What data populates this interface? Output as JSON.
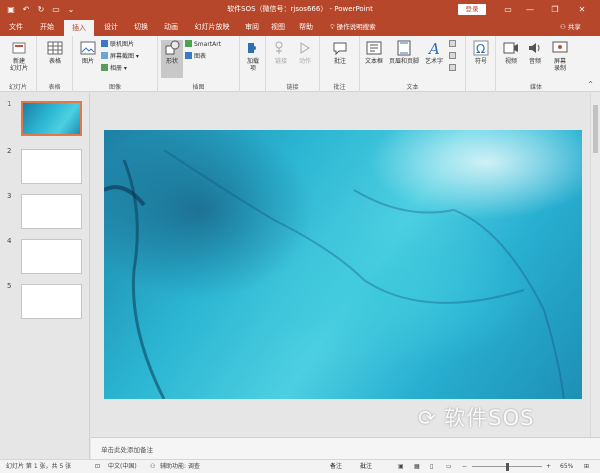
{
  "titlebar": {
    "doc_title": "软件SOS（微信号：rjsos666） - PowerPoint",
    "login": "登录",
    "minimize": "—",
    "restore": "❐",
    "close": "✕"
  },
  "tabs": [
    {
      "label": "文件"
    },
    {
      "label": "开始"
    },
    {
      "label": "插入"
    },
    {
      "label": "设计"
    },
    {
      "label": "切换"
    },
    {
      "label": "动画"
    },
    {
      "label": "幻灯片放映"
    },
    {
      "label": "审阅"
    },
    {
      "label": "视图"
    },
    {
      "label": "帮助"
    }
  ],
  "active_tab": "插入",
  "tell_me": "操作说明搜索",
  "share": "共享",
  "ribbon": {
    "groups": {
      "slides": "幻灯片",
      "tables": "表格",
      "images": "图像",
      "illustrations": "插图",
      "links": "链接",
      "comments": "批注",
      "text": "文本",
      "symbols": "",
      "media": "媒体"
    },
    "buttons": {
      "new_slide": "新建\n幻灯片",
      "table": "表格",
      "pictures": "图片",
      "online_pictures": "联机图片",
      "screenshot": "屏幕截图",
      "album": "相册",
      "shapes": "形状",
      "smartart": "SmartArt",
      "chart": "图表",
      "addins": "加载\n项",
      "link": "链接",
      "action": "动作",
      "comment": "批注",
      "textbox": "文本框",
      "header_footer": "页眉和页脚",
      "wordart": "艺术字",
      "symbol": "符号",
      "video": "视频",
      "audio": "音频",
      "screen_recording": "屏幕\n录制"
    }
  },
  "thumbnails": [
    {
      "num": "1",
      "selected": true
    },
    {
      "num": "2",
      "selected": false
    },
    {
      "num": "3",
      "selected": false
    },
    {
      "num": "4",
      "selected": false
    },
    {
      "num": "5",
      "selected": false
    }
  ],
  "notes_placeholder": "单击此处添加备注",
  "status": {
    "slide_info": "幻灯片 第 1 张，共 5 张",
    "language": "中文(中国)",
    "accessibility": "辅助功能: 调查",
    "notes": "备注",
    "comments": "批注",
    "zoom": "65%"
  },
  "watermark": "软件SOS",
  "colors": {
    "accent": "#b7472a",
    "slide_primary": "#2ab4d1"
  }
}
